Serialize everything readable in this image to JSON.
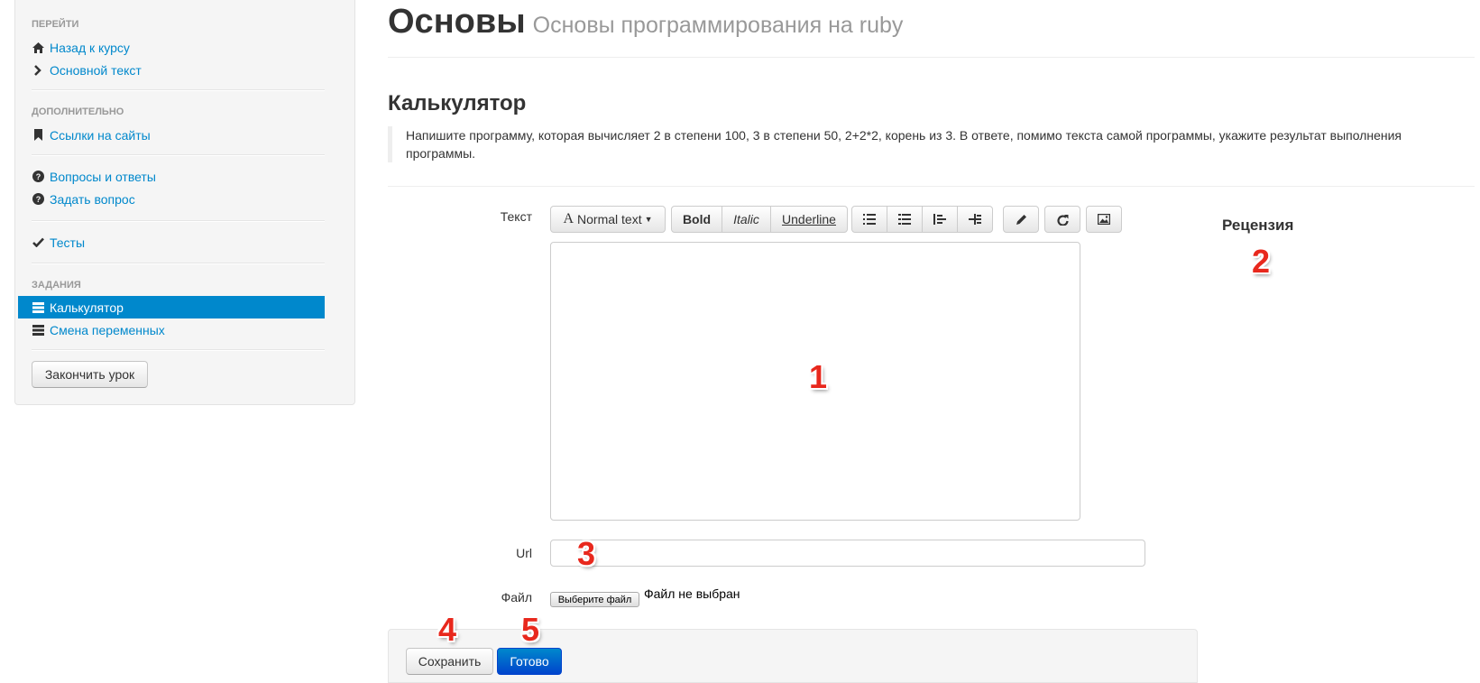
{
  "sidebar": {
    "headers": [
      "ПЕРЕЙТИ",
      "ДОПОЛНИТЕЛЬНО",
      "ЗАДАНИЯ"
    ],
    "items": [
      {
        "label": "Назад к курсу",
        "icon": "home-icon"
      },
      {
        "label": "Основной текст",
        "icon": "chevron-right-icon"
      },
      {
        "label": "Ссылки на сайты",
        "icon": "bookmark-icon"
      },
      {
        "label": "Вопросы и ответы",
        "icon": "question-icon"
      },
      {
        "label": "Задать вопрос",
        "icon": "question-icon"
      },
      {
        "label": "Тесты",
        "icon": "check-icon"
      },
      {
        "label": "Калькулятор",
        "icon": "list-icon",
        "active": true
      },
      {
        "label": "Смена переменных",
        "icon": "list-icon"
      }
    ],
    "finish_button": "Закончить урок",
    "active_color": "#0088cc"
  },
  "header": {
    "title": "Основы",
    "subtitle": "Основы программирования на ruby"
  },
  "task": {
    "title": "Калькулятор",
    "description": "Напишите программу, которая вычисляет 2 в степени 100, 3 в степени 50, 2+2*2, корень из 3. В ответе, помимо текста самой программы, укажите результат выполнения программы."
  },
  "form": {
    "text_label": "Текст",
    "toolbar": {
      "format": "Normal text",
      "bold": "Bold",
      "italic": "Italic",
      "underline": "Underline",
      "icons": [
        "unordered-list-icon",
        "ordered-list-icon",
        "outdent-icon",
        "indent-icon",
        "pencil-icon",
        "redo-icon",
        "image-icon"
      ]
    },
    "editor_value": "",
    "url_label": "Url",
    "url_value": "",
    "file_label": "Файл",
    "file_button": "Выберите файл",
    "file_status": "Файл не выбран",
    "save_button": "Сохранить",
    "done_button": "Готово"
  },
  "review": {
    "title": "Рецензия"
  },
  "markers": [
    "1",
    "2",
    "3",
    "4",
    "5"
  ],
  "colors": {
    "accent": "#0088cc",
    "marker": "#e8281d"
  }
}
